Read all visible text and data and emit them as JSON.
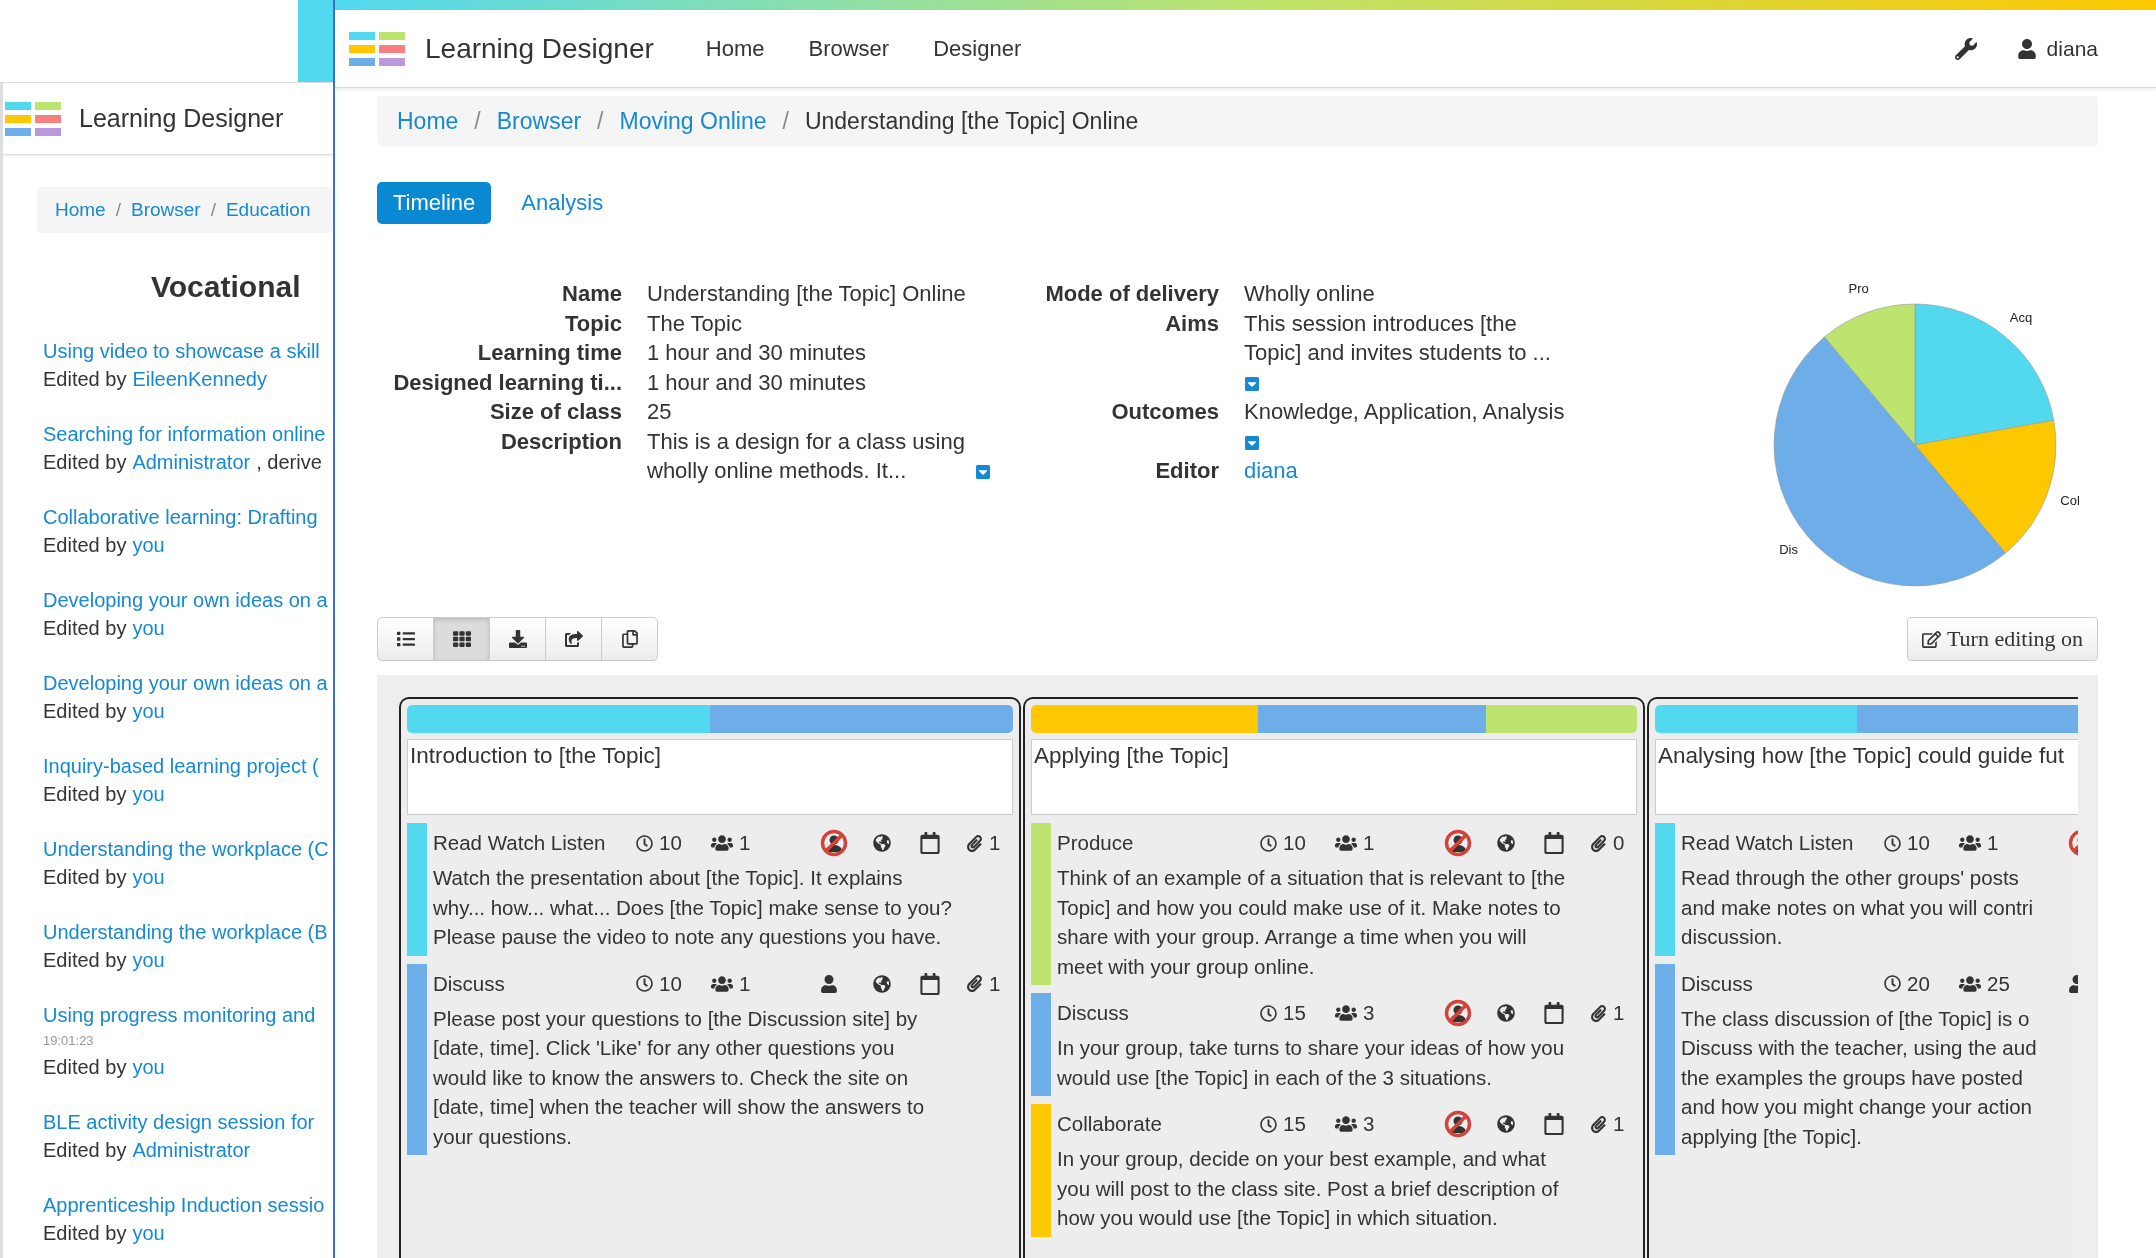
{
  "background_window": {
    "app_title": "Learning Designer",
    "breadcrumb": [
      {
        "label": "Home"
      },
      {
        "label": "Browser",
        "separator": "/"
      },
      {
        "label": "Education",
        "separator": "/"
      }
    ],
    "heading": "Vocational",
    "designs": [
      {
        "title": "Using video to showcase a skill",
        "byline": "Edited by",
        "editor": "EileenKennedy"
      },
      {
        "title": "Searching for information online",
        "byline": "Edited by",
        "editor": "Administrator",
        "suffix": ", derive"
      },
      {
        "title": "Collaborative learning: Drafting",
        "byline": "Edited by",
        "editor": "you"
      },
      {
        "title": "Developing your own ideas on a",
        "byline": "Edited by",
        "editor": "you"
      },
      {
        "title": "Developing your own ideas on a",
        "byline": "Edited by",
        "editor": "you"
      },
      {
        "title": "Inquiry-based learning project (",
        "byline": "Edited by",
        "editor": "you"
      },
      {
        "title": "Understanding the workplace (C",
        "byline": "Edited by",
        "editor": "you"
      },
      {
        "title": "Understanding the workplace (B",
        "byline": "Edited by",
        "editor": "you"
      },
      {
        "title": "Using progress monitoring and",
        "timestamp": "19:01:23",
        "byline": "Edited by",
        "editor": "you"
      },
      {
        "title": "BLE activity design session for",
        "byline": "Edited by",
        "editor": "Administrator"
      },
      {
        "title": "Apprenticeship Induction sessio",
        "byline": "Edited by",
        "editor": "you"
      }
    ]
  },
  "app": {
    "title": "Learning Designer",
    "nav": [
      {
        "label": "Home"
      },
      {
        "label": "Browser"
      },
      {
        "label": "Designer"
      }
    ],
    "user": "diana"
  },
  "breadcrumb": [
    {
      "label": "Home",
      "link": true
    },
    {
      "label": "Browser",
      "link": true,
      "separator": "/"
    },
    {
      "label": "Moving Online",
      "link": true,
      "separator": "/"
    },
    {
      "label": "Understanding [the Topic] Online",
      "link": false,
      "separator": "/"
    }
  ],
  "tabs": [
    {
      "label": "Timeline",
      "selected": true
    },
    {
      "label": "Analysis",
      "selected": false
    }
  ],
  "details_left": [
    {
      "label": "Name",
      "lines": [
        "Understanding [the Topic] Online"
      ]
    },
    {
      "label": "Topic",
      "lines": [
        "The Topic"
      ]
    },
    {
      "label": "Learning time",
      "lines": [
        "1 hour and 30 minutes"
      ]
    },
    {
      "label": "Designed learning ti...",
      "lines": [
        "1 hour and 30 minutes"
      ]
    },
    {
      "label": "Size of class",
      "lines": [
        "25"
      ]
    },
    {
      "label": "Description",
      "lines": [
        "This is a design for a class using",
        "wholly online methods. It..."
      ],
      "expand": true
    }
  ],
  "details_right": [
    {
      "label": "Mode of delivery",
      "lines": [
        "Wholly online"
      ]
    },
    {
      "label": "Aims",
      "lines": [
        "This session introduces [the",
        "Topic] and invites students to ..."
      ],
      "expand": true
    },
    {
      "label": "Outcomes",
      "lines": [
        "Knowledge, Application, Analysis"
      ],
      "expand": true
    },
    {
      "label": "Editor",
      "lines": [
        "diana"
      ],
      "link": true
    }
  ],
  "chart": {
    "chart_data": {
      "type": "pie",
      "categories": [
        "Acq",
        "Col",
        "Dis",
        "Pro"
      ],
      "values": [
        22.2,
        16.7,
        50,
        11.1
      ],
      "colors": [
        "#52d9f0",
        "#fdc800",
        "#6eaee8",
        "#bde46e"
      ]
    }
  },
  "toolbar": [
    {
      "kind": "list",
      "selected": false
    },
    {
      "kind": "grid",
      "selected": true
    },
    {
      "kind": "download",
      "selected": false
    },
    {
      "kind": "share",
      "selected": false
    },
    {
      "kind": "copy",
      "selected": false
    }
  ],
  "edit_button": {
    "label": "Turn editing on"
  },
  "columns": [
    {
      "title": "Introduction to [the Topic]",
      "activities": [
        {
          "kind": "acquisition",
          "name": "Read Watch Listen",
          "time": "10",
          "group": "1",
          "presence": false,
          "attachments": "1",
          "lines": [
            "Watch the presentation about [the Topic]. It explains",
            "why... how... what... Does [the Topic] make sense to you?",
            "Please pause the video to note any questions you have."
          ]
        },
        {
          "kind": "discussion",
          "name": "Discuss",
          "time": "10",
          "group": "1",
          "presence": true,
          "attachments": "1",
          "lines": [
            "Please post your questions to [the Discussion site] by",
            "[date, time]. Click 'Like' for any other questions you",
            "would like to know the answers to. Check the site on",
            "[date, time] when the teacher will show the answers to",
            "your questions."
          ]
        }
      ]
    },
    {
      "title": "Applying [the Topic]",
      "activities": [
        {
          "kind": "production",
          "name": "Produce",
          "time": "10",
          "group": "1",
          "presence": false,
          "attachments": "0",
          "lines": [
            "Think of an example of a situation that is relevant to [the",
            "Topic] and how you could make use of it. Make notes to",
            "share with your group. Arrange a time when you will",
            "meet with your group online."
          ]
        },
        {
          "kind": "discussion",
          "name": "Discuss",
          "time": "15",
          "group": "3",
          "presence": false,
          "attachments": "1",
          "lines": [
            "In your group, take turns to share your ideas of how you",
            "would use [the Topic] in each of the 3 situations."
          ]
        },
        {
          "kind": "collaboration",
          "name": "Collaborate",
          "time": "15",
          "group": "3",
          "presence": false,
          "attachments": "1",
          "lines": [
            "In your group, decide on your best example, and what",
            "you will post to the class site. Post a brief description of",
            "how you would use [the Topic] in which situation."
          ]
        }
      ]
    },
    {
      "title": "Analysing how [the Topic] could guide fut",
      "activities": [
        {
          "kind": "acquisition",
          "name": "Read Watch Listen",
          "time": "10",
          "group": "1",
          "presence": false,
          "lines": [
            "Read through the other groups' posts",
            "and make notes on what you will contri",
            "discussion."
          ]
        },
        {
          "kind": "discussion",
          "name": "Discuss",
          "time": "20",
          "group": "25",
          "presence": true,
          "lines": [
            "The class discussion of [the Topic] is o",
            "Discuss with the teacher, using the aud",
            "the examples the groups have posted",
            "and how you might change your action",
            "applying [the Topic]."
          ]
        }
      ]
    }
  ]
}
